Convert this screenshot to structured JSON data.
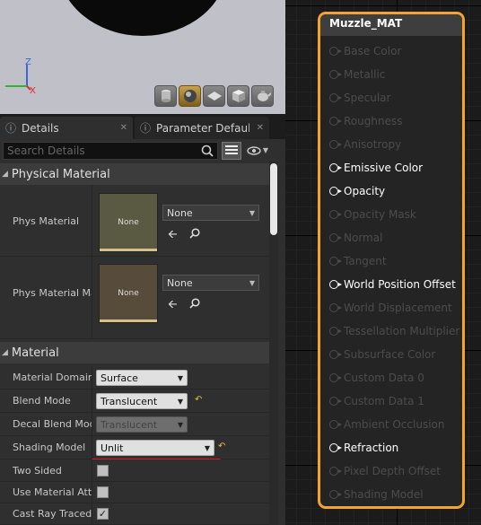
{
  "tabs": {
    "details": "Details",
    "parameter_defaults": "Parameter Defaults"
  },
  "search": {
    "placeholder": "Search Details"
  },
  "physical_material": {
    "header": "Physical Material",
    "rows": [
      {
        "label": "Phys Material",
        "thumb": "None",
        "value": "None"
      },
      {
        "label": "Phys Material Ma",
        "thumb": "None",
        "value": "None"
      }
    ]
  },
  "material": {
    "header": "Material",
    "material_domain": {
      "label": "Material Domain",
      "value": "Surface"
    },
    "blend_mode": {
      "label": "Blend Mode",
      "value": "Translucent"
    },
    "decal_blend_mode": {
      "label": "Decal Blend Mode",
      "value": "Translucent"
    },
    "shading_model": {
      "label": "Shading Model",
      "value": "Unlit"
    },
    "two_sided": {
      "label": "Two Sided",
      "checked": false
    },
    "use_material_attributes": {
      "label": "Use Material Attri",
      "checked": false
    },
    "cast_ray_traced": {
      "label": "Cast Ray Traced S",
      "checked": true
    }
  },
  "node": {
    "title": "Muzzle_MAT",
    "pins": [
      {
        "label": "Base Color",
        "active": false
      },
      {
        "label": "Metallic",
        "active": false
      },
      {
        "label": "Specular",
        "active": false
      },
      {
        "label": "Roughness",
        "active": false
      },
      {
        "label": "Anisotropy",
        "active": false
      },
      {
        "label": "Emissive Color",
        "active": true
      },
      {
        "label": "Opacity",
        "active": true
      },
      {
        "label": "Opacity Mask",
        "active": false
      },
      {
        "label": "Normal",
        "active": false
      },
      {
        "label": "Tangent",
        "active": false
      },
      {
        "label": "World Position Offset",
        "active": true
      },
      {
        "label": "World Displacement",
        "active": false
      },
      {
        "label": "Tessellation Multiplier",
        "active": false
      },
      {
        "label": "Subsurface Color",
        "active": false
      },
      {
        "label": "Custom Data 0",
        "active": false
      },
      {
        "label": "Custom Data 1",
        "active": false
      },
      {
        "label": "Ambient Occlusion",
        "active": false
      },
      {
        "label": "Refraction",
        "active": true
      },
      {
        "label": "Pixel Depth Offset",
        "active": false
      },
      {
        "label": "Shading Model",
        "active": false
      }
    ]
  },
  "colors": {
    "node_border": "#f2a42e",
    "highlight_underline": "#e01818",
    "reset_arrow": "#e0c030"
  },
  "icons": {
    "viewport_buttons": [
      "cylinder-icon",
      "sphere-icon",
      "plane-icon",
      "cube-icon",
      "teapot-icon"
    ]
  }
}
